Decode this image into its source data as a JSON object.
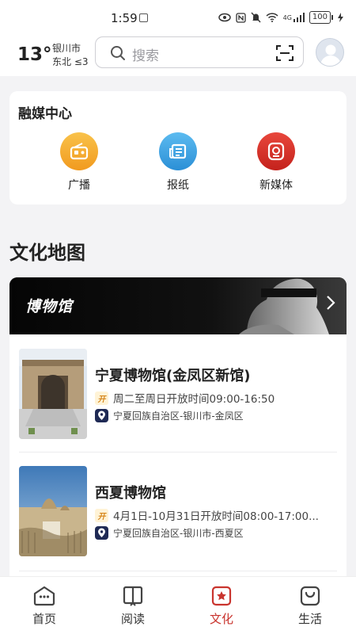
{
  "status_bar": {
    "time": "1:59",
    "battery": "100",
    "network": "4G"
  },
  "header": {
    "weather": {
      "temperature": "13°",
      "city": "银川市",
      "wind": "东北  ≤3"
    },
    "search": {
      "placeholder": "搜索"
    }
  },
  "media_center": {
    "title": "融媒中心",
    "items": [
      {
        "label": "广播",
        "icon": "radio-icon",
        "color": "#f5a623"
      },
      {
        "label": "报纸",
        "icon": "newspaper-icon",
        "color": "#3aa3e3"
      },
      {
        "label": "新媒体",
        "icon": "new-media-icon",
        "color": "#d9322b"
      }
    ]
  },
  "culture_map": {
    "title": "文化地图",
    "banner_title": "博物馆",
    "museums": [
      {
        "name": "宁夏博物馆(金凤区新馆)",
        "open_badge": "开",
        "hours": "周二至周日开放时间09:00-16:50",
        "location": "宁夏回族自治区-银川市-金凤区"
      },
      {
        "name": "西夏博物馆",
        "open_badge": "开",
        "hours": "4月1日-10月31日开放时间08:00-17:00...",
        "location": "宁夏回族自治区-银川市-西夏区"
      }
    ]
  },
  "tabbar": {
    "active_color": "#c9342e",
    "tabs": [
      {
        "label": "首页",
        "icon": "home-icon"
      },
      {
        "label": "阅读",
        "icon": "book-icon"
      },
      {
        "label": "文化",
        "icon": "culture-icon",
        "active": true
      },
      {
        "label": "生活",
        "icon": "bag-icon"
      }
    ]
  }
}
